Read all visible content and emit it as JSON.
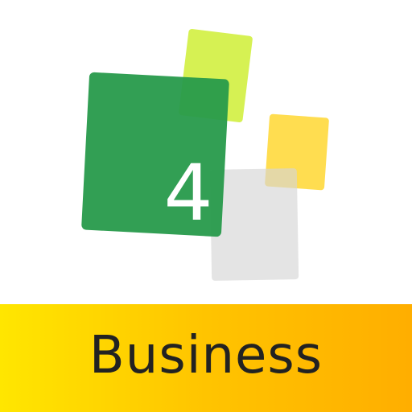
{
  "app_icon": {
    "number": "4",
    "banner_label": "Business"
  },
  "colors": {
    "green_card": "#2f9c4f",
    "lime_card": "#d2f040",
    "yellow_card": "#ffd93d",
    "gray_card": "#dedede",
    "banner_start": "#ffe600",
    "banner_end": "#ffae00",
    "banner_text": "#222222"
  }
}
